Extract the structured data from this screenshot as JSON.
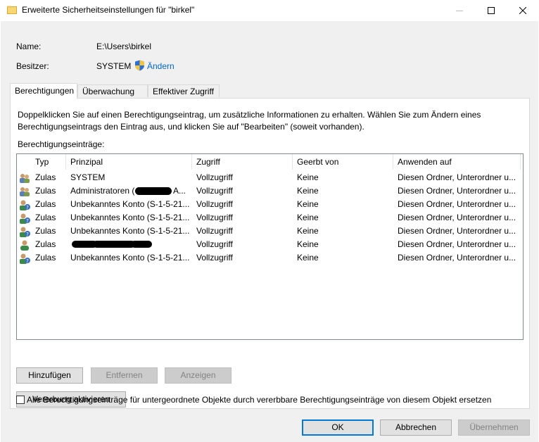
{
  "window": {
    "title": "Erweiterte Sicherheitseinstellungen für \"birkel\"",
    "minimize_icon": "—",
    "maximize_icon": "☐",
    "close_icon": "✕"
  },
  "owner_section": {
    "name_label": "Name:",
    "name_value": "E:\\Users\\birkel",
    "owner_label": "Besitzer:",
    "owner_value": "SYSTEM",
    "change_link": "Ändern"
  },
  "tabs": [
    {
      "label": "Berechtigungen",
      "active": true
    },
    {
      "label": "Überwachung",
      "active": false
    },
    {
      "label": "Effektiver Zugriff",
      "active": false
    }
  ],
  "permissions": {
    "description": "Doppelklicken Sie auf einen Berechtigungseintrag, um zusätzliche Informationen zu erhalten. Wählen Sie zum Ändern eines Berechtigungseintrags den Eintrag aus, und klicken Sie auf \"Bearbeiten\" (soweit vorhanden).",
    "entries_label": "Berechtigungseinträge:",
    "columns": [
      "Typ",
      "Prinzipal",
      "Zugriff",
      "Geerbt von",
      "Anwenden auf"
    ],
    "rows": [
      {
        "icon": "group-icon",
        "typ": "Zulas",
        "prinzipal": "SYSTEM",
        "zugriff": "Vollzugriff",
        "geerbt": "Keine",
        "anwenden": "Diesen Ordner, Unterordner u..."
      },
      {
        "icon": "group-icon",
        "typ": "Zulas",
        "prinzipal": "Administratoren (",
        "prinzipal_suffix": "A...",
        "zugriff": "Vollzugriff",
        "geerbt": "Keine",
        "anwenden": "Diesen Ordner, Unterordner u..."
      },
      {
        "icon": "unknown-user-icon",
        "typ": "Zulas",
        "prinzipal": "Unbekanntes Konto (S-1-5-21...",
        "zugriff": "Vollzugriff",
        "geerbt": "Keine",
        "anwenden": "Diesen Ordner, Unterordner u..."
      },
      {
        "icon": "unknown-user-icon",
        "typ": "Zulas",
        "prinzipal": "Unbekanntes Konto (S-1-5-21...",
        "zugriff": "Vollzugriff",
        "geerbt": "Keine",
        "anwenden": "Diesen Ordner, Unterordner u..."
      },
      {
        "icon": "unknown-user-icon",
        "typ": "Zulas",
        "prinzipal": "Unbekanntes Konto (S-1-5-21...",
        "zugriff": "Vollzugriff",
        "geerbt": "Keine",
        "anwenden": "Diesen Ordner, Unterordner u..."
      },
      {
        "icon": "user-icon",
        "typ": "Zulas",
        "prinzipal": "",
        "zugriff": "Vollzugriff",
        "geerbt": "Keine",
        "anwenden": "Diesen Ordner, Unterordner u..."
      },
      {
        "icon": "unknown-user-icon",
        "typ": "Zulas",
        "prinzipal": "Unbekanntes Konto (S-1-5-21...",
        "zugriff": "Vollzugriff",
        "geerbt": "Keine",
        "anwenden": "Diesen Ordner, Unterordner u..."
      }
    ]
  },
  "buttons": {
    "add": "Hinzufügen",
    "remove": "Entfernen",
    "view": "Anzeigen",
    "inheritance": "Vererbung aktivieren",
    "replace_checkbox_label": "Alle Berechtigungseinträge für untergeordnete Objekte durch vererbbare Berechtigungseinträge von diesem Objekt ersetzen",
    "ok": "OK",
    "cancel": "Abbrechen",
    "apply": "Übernehmen"
  },
  "colors": {
    "link": "#0066cc",
    "default_button_border": "#0078d7"
  }
}
